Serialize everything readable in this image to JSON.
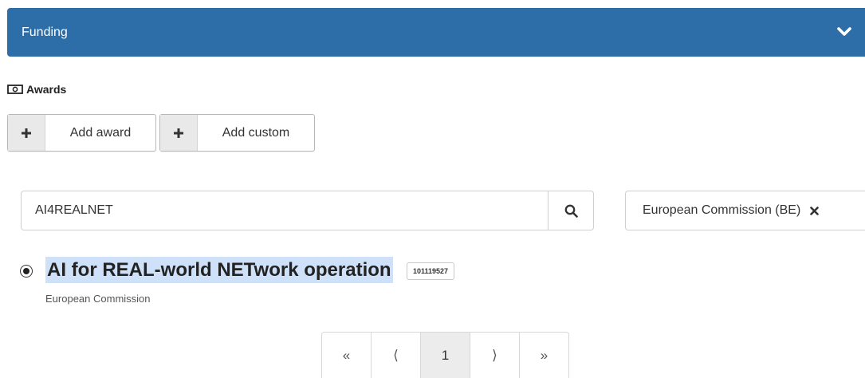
{
  "funding": {
    "title": "Funding",
    "chevron_icon": "chevron-down-icon"
  },
  "awards": {
    "label": "Awards",
    "icon": "money-bill-icon",
    "add_award_label": "Add award",
    "add_custom_label": "Add custom"
  },
  "search": {
    "value": "AI4REALNET",
    "icon": "search-icon"
  },
  "funder_filter": {
    "value": "European Commission (BE)",
    "clear_icon": "close-icon"
  },
  "result": {
    "selected": true,
    "title": "AI for REAL-world NETwork operation",
    "number": "101119527",
    "funder": "European Commission"
  },
  "pagination": {
    "first": "«",
    "prev": "⟨",
    "current": "1",
    "next": "⟩",
    "last": "»"
  },
  "colors": {
    "header_bg": "#2d6ea8",
    "highlight": "#cfe1f8"
  }
}
